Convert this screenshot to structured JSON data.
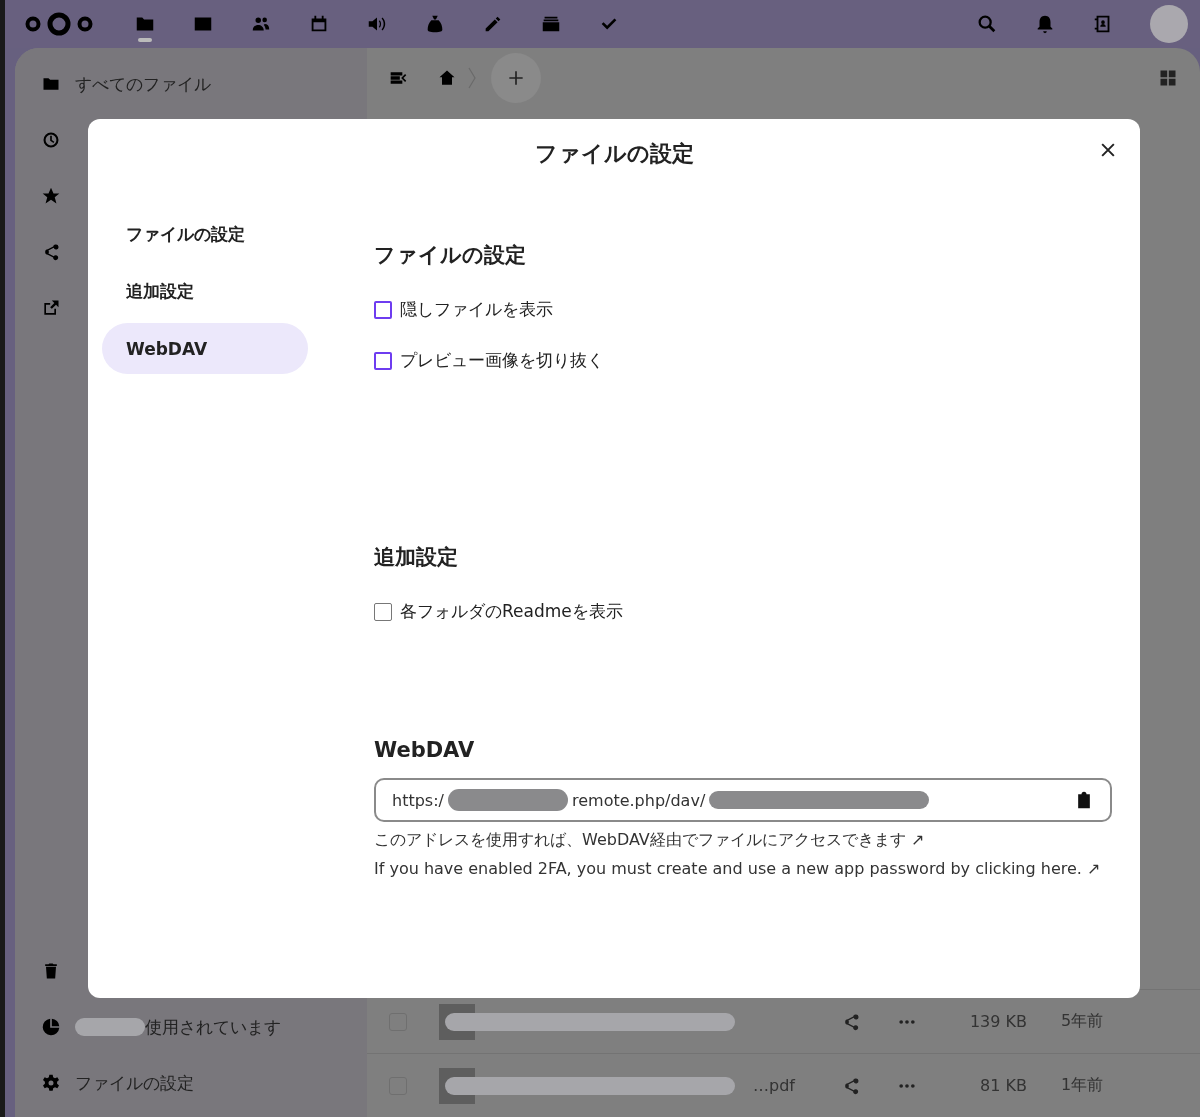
{
  "header": {
    "apps": [
      {
        "kind": "folder",
        "selected": true
      },
      {
        "kind": "image",
        "selected": false
      },
      {
        "kind": "people",
        "selected": false
      },
      {
        "kind": "calendar",
        "selected": false
      },
      {
        "kind": "speaker",
        "selected": false
      },
      {
        "kind": "moneybag",
        "selected": false
      },
      {
        "kind": "pencil",
        "selected": false
      },
      {
        "kind": "stack",
        "selected": false
      },
      {
        "kind": "check",
        "selected": false
      }
    ]
  },
  "sidebar": {
    "items": [
      {
        "kind": "folder",
        "label": "すべてのファイル"
      },
      {
        "kind": "clock"
      },
      {
        "kind": "star"
      },
      {
        "kind": "share"
      },
      {
        "kind": "external"
      }
    ],
    "usage": {
      "label": "使用されています"
    },
    "settings": {
      "label": "ファイルの設定"
    }
  },
  "files": {
    "rows": [
      {
        "name": "",
        "size": "139 KB",
        "modified": "5年前",
        "checked": false
      },
      {
        "name": "…pdf",
        "size": "81 KB",
        "modified": "1年前",
        "checked": false
      }
    ]
  },
  "dialog": {
    "title": "ファイルの設定",
    "nav": [
      {
        "label": "ファイルの設定",
        "selected": false
      },
      {
        "label": "追加設定",
        "selected": false
      },
      {
        "label": "WebDAV",
        "selected": true
      }
    ],
    "sections": [
      {
        "heading": "ファイルの設定",
        "options": [
          {
            "kind": "styled",
            "label": "隠しファイルを表示",
            "checked": false
          },
          {
            "kind": "styled",
            "label": "プレビュー画像を切り抜く",
            "checked": false
          }
        ]
      },
      {
        "heading": "追加設定",
        "options": [
          {
            "kind": "native",
            "label": "各フォルダのReadmeを表示",
            "checked": false
          }
        ]
      }
    ],
    "webdav": {
      "heading": "WebDAV",
      "url_start": "https:/",
      "url_middle": "remote.php/dav/",
      "hint": "このアドレスを使用すれば、WebDAV経由でファイルにアクセスできます ↗",
      "twofa": "If you have enabled 2FA, you must create and use a new app password by clicking here. ↗"
    }
  }
}
